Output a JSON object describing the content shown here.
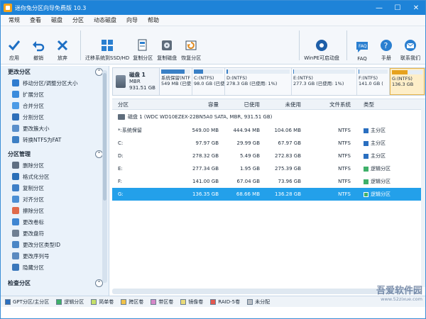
{
  "title": "迷你兔分区向导免费版 10.3",
  "menu": [
    "常规",
    "查看",
    "磁盘",
    "分区",
    "动态磁盘",
    "向导",
    "帮助"
  ],
  "toolbar": {
    "apply": "应用",
    "undo": "撤销",
    "discard": "放弃",
    "migrate": "迁移系统到SSD/HD",
    "copy_partition": "复制分区",
    "copy_disk": "复制磁盘",
    "restore_partition": "恢复分区",
    "winpe": "WinPE可启动盘",
    "faq": "FAQ",
    "manual": "手册",
    "contact": "联系我们"
  },
  "sidebar": {
    "sections": [
      {
        "title": "更改分区",
        "items": [
          "移动分区/调整分区大小",
          "扩展分区",
          "合并分区",
          "分割分区",
          "更改簇大小",
          "转换NTFS为FAT"
        ]
      },
      {
        "title": "分区管理",
        "items": [
          "删除分区",
          "格式化分区",
          "复制分区",
          "对齐分区",
          "擦除分区",
          "更改卷标",
          "更改盘符",
          "更改分区类型ID",
          "更改序列号",
          "隐藏分区"
        ]
      },
      {
        "title": "检查分区",
        "items": []
      }
    ]
  },
  "disk_map": {
    "disk_name": "磁盘 1",
    "disk_style": "MBR",
    "disk_size": "931.51 GB",
    "partitions": [
      {
        "label": "系统保留(NTF",
        "size": "549 MB (已使",
        "fill": 0.81,
        "selected": false
      },
      {
        "label": "C:(NTFS)",
        "size": "98.0 GB (已使",
        "fill": 0.31,
        "selected": false
      },
      {
        "label": "D:(NTFS)",
        "size": "278.3 GB (已使用: 1%)",
        "fill": 0.02,
        "selected": false
      },
      {
        "label": "E:(NTFS)",
        "size": "277.3 GB (已使用: 1%)",
        "fill": 0.01,
        "selected": false
      },
      {
        "label": "F:(NTFS)",
        "size": "141.0 GB (",
        "fill": 0.01,
        "selected": false
      },
      {
        "label": "G:(NTFS)",
        "size": "136.3 GB",
        "fill": 0.5,
        "selected": true
      }
    ]
  },
  "table": {
    "headers": [
      "分区",
      "容量",
      "已使用",
      "未使用",
      "文件系统",
      "类型"
    ],
    "disk_row": "磁盘 1 (WDC WD10EZEX-22BN5A0 SATA, MBR, 931.51 GB)",
    "rows": [
      {
        "name": "*:系统保留",
        "capacity": "549.00 MB",
        "used": "444.94 MB",
        "unused": "104.06 MB",
        "fs": "NTFS",
        "type": "主分区",
        "type_color": "#2a6fc0",
        "selected": false
      },
      {
        "name": "C:",
        "capacity": "97.97 GB",
        "used": "29.99 GB",
        "unused": "67.97 GB",
        "fs": "NTFS",
        "type": "主分区",
        "type_color": "#2a6fc0",
        "selected": false
      },
      {
        "name": "D:",
        "capacity": "278.32 GB",
        "used": "5.49 GB",
        "unused": "272.83 GB",
        "fs": "NTFS",
        "type": "主分区",
        "type_color": "#2a6fc0",
        "selected": false
      },
      {
        "name": "E:",
        "capacity": "277.34 GB",
        "used": "1.95 GB",
        "unused": "275.39 GB",
        "fs": "NTFS",
        "type": "逻辑分区",
        "type_color": "#3fb06a",
        "selected": false
      },
      {
        "name": "F:",
        "capacity": "141.00 GB",
        "used": "67.04 GB",
        "unused": "73.96 GB",
        "fs": "NTFS",
        "type": "逻辑分区",
        "type_color": "#3fb06a",
        "selected": false
      },
      {
        "name": "G:",
        "capacity": "136.35 GB",
        "used": "68.66 MB",
        "unused": "136.28 GB",
        "fs": "NTFS",
        "type": "逻辑分区",
        "type_color": "#3fb06a",
        "selected": true
      }
    ]
  },
  "legend": [
    {
      "label": "GPT分区/主分区",
      "color": "#2a6fc0"
    },
    {
      "label": "逻辑分区",
      "color": "#3fb06a"
    },
    {
      "label": "简单卷",
      "color": "#c6e06a"
    },
    {
      "label": "跨区卷",
      "color": "#f0c24a"
    },
    {
      "label": "带区卷",
      "color": "#d688c8"
    },
    {
      "label": "镜像卷",
      "color": "#eadb7a"
    },
    {
      "label": "RAID-5卷",
      "color": "#e3584f"
    },
    {
      "label": "未分配",
      "color": "#b9bec4"
    }
  ],
  "watermark": {
    "line1": "吾爱软件园",
    "line2": "www.52zixue.com"
  },
  "colors": {
    "titlebar": "#1e83d8",
    "selection": "#23a0ea",
    "accent": "#2a6fc0"
  }
}
